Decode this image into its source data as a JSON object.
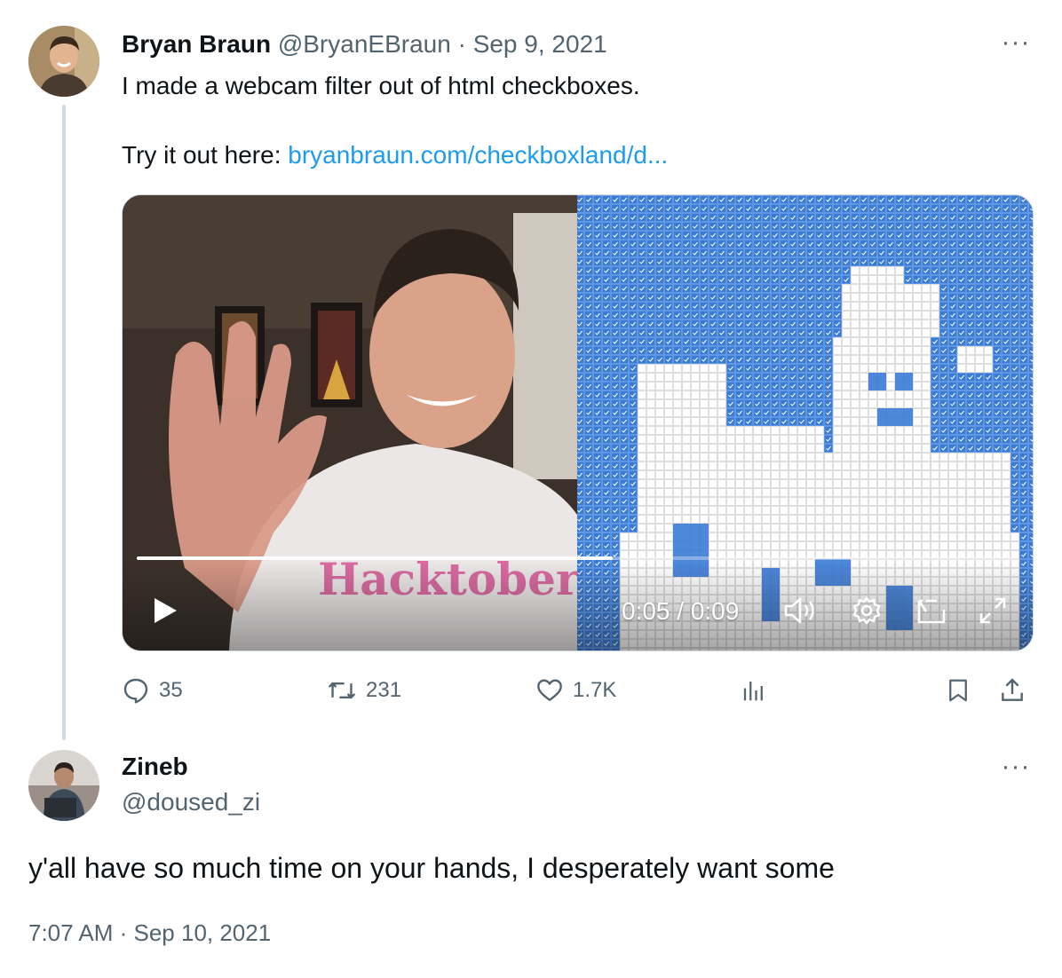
{
  "tweet": {
    "author_name": "Bryan Braun",
    "author_handle": "@BryanEBraun",
    "separator": "·",
    "date": "Sep 9, 2021",
    "more_label": "···",
    "text_line1": "I made a webcam filter out of html checkboxes.",
    "text_line2_prefix": "Try it out here: ",
    "link_text": "bryanbraun.com/checkboxland/d...",
    "video": {
      "timecode": "0:05 / 0:09",
      "progress": 0.54
    },
    "actions": {
      "replies": "35",
      "reposts": "231",
      "likes": "1.7K"
    },
    "icons": [
      "reply-icon",
      "repost-icon",
      "like-icon",
      "views-icon",
      "bookmark-icon",
      "share-icon",
      "play-icon",
      "volume-icon",
      "settings-icon",
      "pip-icon",
      "fullscreen-icon"
    ]
  },
  "reply": {
    "author_name": "Zineb",
    "author_handle": "@doused_zi",
    "more_label": "···",
    "text": "y'all have so much time on your hands, I desperately want some",
    "timestamp": "7:07 AM · Sep 10, 2021"
  },
  "colors": {
    "link": "#1d9bf0",
    "muted": "#536471",
    "text": "#0f1419",
    "checkbox_blue": "#3a7bd5"
  }
}
